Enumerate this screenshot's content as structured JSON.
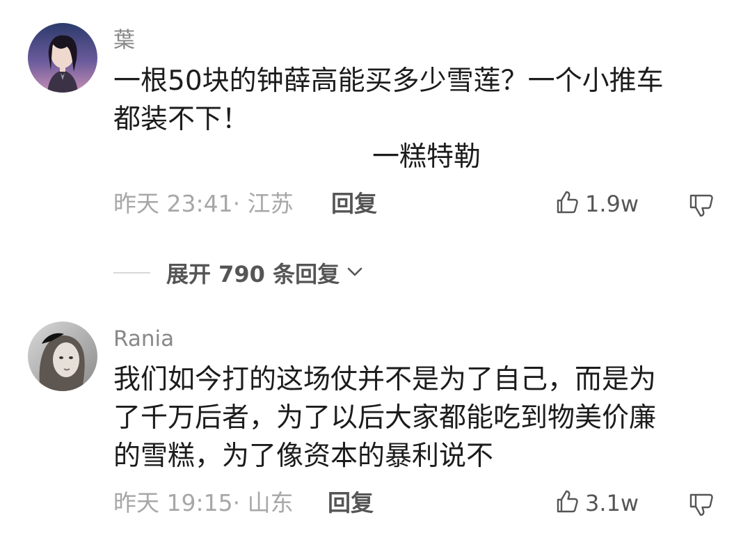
{
  "comments": [
    {
      "username": "葉",
      "lines": [
        "一根50块的钟薛高能买多少雪莲？一个小推车",
        "都装不下！"
      ],
      "signature": "一糕特勒",
      "meta": "昨天 23:41· 江苏",
      "reply_label": "回复",
      "likes": "1.9w"
    },
    {
      "username": "Rania",
      "lines": [
        "我们如今打的这场仗并不是为了自己，而是为",
        "了千万后者，为了以后大家都能吃到物美价廉",
        "的雪糕，为了像资本的暴利说不"
      ],
      "meta": "昨天 19:15· 山东",
      "reply_label": "回复",
      "likes": "3.1w"
    }
  ],
  "expand": {
    "label": "展开 790 条回复"
  },
  "icons": {
    "like": "thumbs-up-icon",
    "dislike": "thumbs-down-icon",
    "expand": "chevron-down-icon"
  },
  "colors": {
    "meta": "#a7a7a7",
    "action": "#555555",
    "body": "#1c1c1c"
  }
}
